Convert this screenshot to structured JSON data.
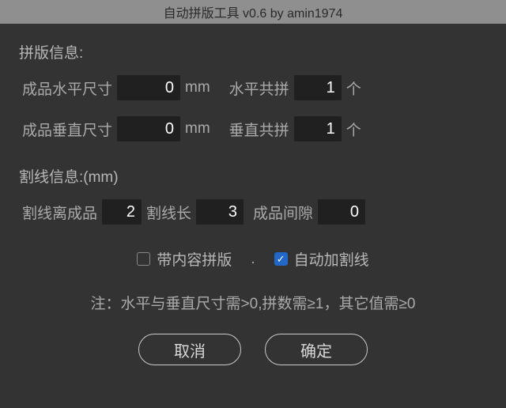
{
  "title": "自动拼版工具 v0.6    by amin1974",
  "section1": {
    "heading": "拼版信息:",
    "hSizeLabel": "成品水平尺寸",
    "hSizeValue": "0",
    "mm1": "mm",
    "hCountLabel": "水平共拼",
    "hCountValue": "1",
    "unitGe1": "个",
    "vSizeLabel": "成品垂直尺寸",
    "vSizeValue": "0",
    "mm2": "mm",
    "vCountLabel": "垂直共拼",
    "vCountValue": "1",
    "unitGe2": "个"
  },
  "section2": {
    "heading": "割线信息:(mm)",
    "distLabel": "割线离成品",
    "distValue": "2",
    "lenLabel": "割线长",
    "lenValue": "3",
    "gapLabel": "成品间隙",
    "gapValue": "0"
  },
  "checks": {
    "check1Label": "带内容拼版",
    "dot": ".",
    "check2Label": "自动加割线",
    "check1": false,
    "check2": true
  },
  "note": "注：水平与垂直尺寸需>0,拼数需≥1，其它值需≥0",
  "buttons": {
    "cancel": "取消",
    "ok": "确定"
  }
}
